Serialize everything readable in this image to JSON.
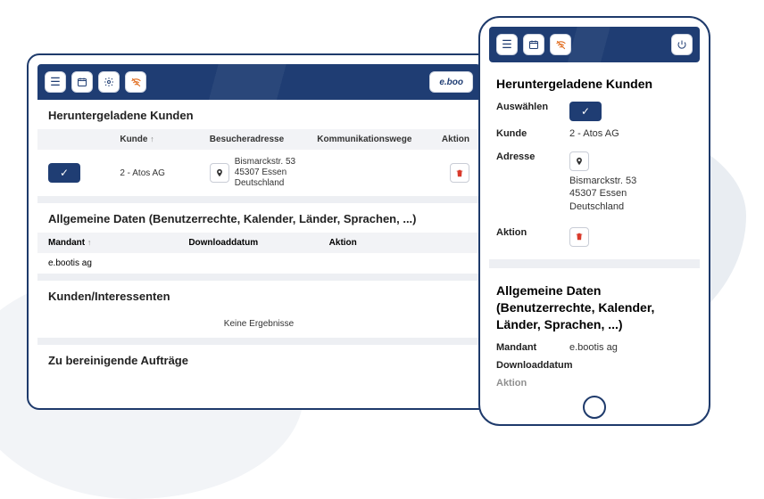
{
  "brand": "e.boo",
  "colors": {
    "primary": "#1f3d73",
    "accent": "#e06a1b",
    "danger": "#d93a2b"
  },
  "tablet": {
    "sections": {
      "customers": {
        "title": "Heruntergeladene Kunden",
        "columns": {
          "c2": "Kunde",
          "c3": "Besucheradresse",
          "c4": "Kommunikationswege",
          "c5": "Aktion"
        },
        "row": {
          "kunde": "2 - Atos AG",
          "addr1": "Bismarckstr. 53",
          "addr2": "45307 Essen",
          "addr3": "Deutschland"
        }
      },
      "general": {
        "title": "Allgemeine Daten (Benutzerrechte, Kalender, Länder, Sprachen, ...)",
        "columns": {
          "c1": "Mandant",
          "c2": "Downloaddatum",
          "c3": "Aktion"
        },
        "row": {
          "mandant": "e.bootis ag"
        }
      },
      "kundenInteressenten": {
        "title": "Kunden/Interessenten",
        "empty": "Keine Ergebnisse"
      },
      "bereinigen": {
        "title": "Zu bereinigende Aufträge"
      }
    }
  },
  "phone": {
    "customers": {
      "title": "Heruntergeladene Kunden",
      "labels": {
        "auswaehlen": "Auswählen",
        "kunde": "Kunde",
        "adresse": "Adresse",
        "aktion": "Aktion"
      },
      "values": {
        "kunde": "2 - Atos AG",
        "addr1": "Bismarckstr. 53",
        "addr2": "45307 Essen",
        "addr3": "Deutschland"
      }
    },
    "general": {
      "title": "Allgemeine Daten (Benutzerrechte, Kalender, Länder, Sprachen, ...)",
      "labels": {
        "mandant": "Mandant",
        "download": "Downloaddatum",
        "aktion": "Aktion"
      },
      "values": {
        "mandant": "e.bootis ag"
      }
    }
  }
}
